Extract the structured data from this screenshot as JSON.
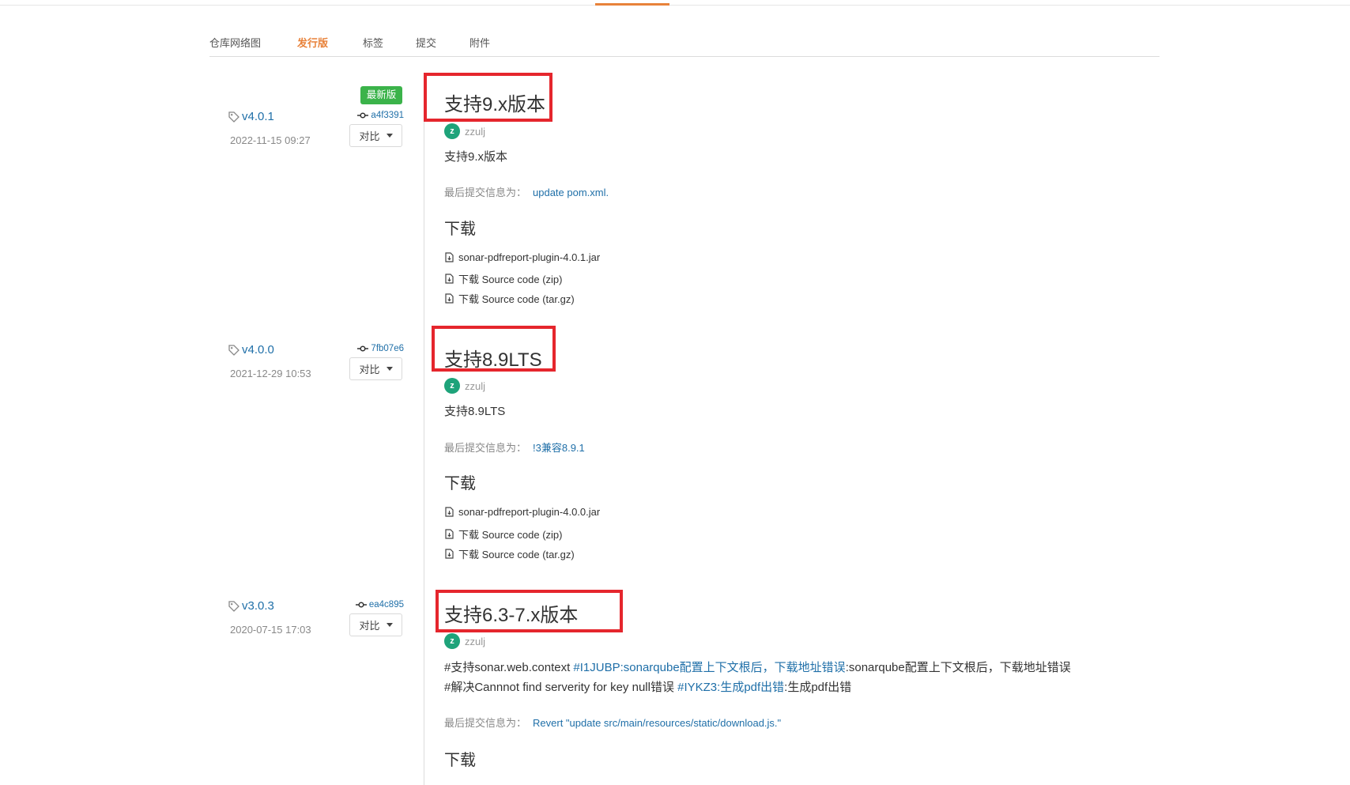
{
  "tabs": [
    "仓库网络图",
    "发行版",
    "标签",
    "提交",
    "附件"
  ],
  "active_tab": "发行版",
  "colors": {
    "accent": "#e8823a",
    "link": "#1f6fa8",
    "badge": "#3bb34a",
    "highlight_box": "#e5262d",
    "avatar": "#1ea37a"
  },
  "icons": {
    "tag": "tag-icon",
    "commit": "commit-icon",
    "file": "file-icon",
    "caret": "caret-down-icon"
  },
  "releases": [
    {
      "tag": "v4.0.1",
      "date": "2022-11-15 09:27",
      "commit": "a4f3391",
      "latest_label": "最新版",
      "compare_label": "对比",
      "title": "支持9.x版本",
      "author_initial": "z",
      "author": "zzulj",
      "description": [
        "支持9.x版本"
      ],
      "last_commit_label": "最后提交信息为：",
      "last_commit_message": "update pom.xml.",
      "download_title": "下载",
      "files": [
        "sonar-pdfreport-plugin-4.0.1.jar",
        "下载 Source code (zip)",
        "下载 Source code (tar.gz)"
      ]
    },
    {
      "tag": "v4.0.0",
      "date": "2021-12-29 10:53",
      "commit": "7fb07e6",
      "compare_label": "对比",
      "title": "支持8.9LTS",
      "author_initial": "z",
      "author": "zzulj",
      "description": [
        "支持8.9LTS"
      ],
      "last_commit_label": "最后提交信息为：",
      "last_commit_message": "!3兼容8.9.1",
      "download_title": "下载",
      "files": [
        "sonar-pdfreport-plugin-4.0.0.jar",
        "下载 Source code (zip)",
        "下载 Source code (tar.gz)"
      ]
    },
    {
      "tag": "v3.0.3",
      "date": "2020-07-15 17:03",
      "commit": "ea4c895",
      "compare_label": "对比",
      "title": "支持6.3-7.x版本",
      "author_initial": "z",
      "author": "zzulj",
      "description_line1": {
        "prefix": "#支持sonar.web.context ",
        "link": "#I1JUBP:sonarqube配置上下文根后，下载地址错误",
        "suffix": ":sonarqube配置上下文根后，下载地址错误"
      },
      "description_line2": {
        "prefix": "#解决Cannnot find serverity for key null错误 ",
        "link": "#IYKZ3:生成pdf出错",
        "suffix": ":生成pdf出错"
      },
      "last_commit_label": "最后提交信息为：",
      "last_commit_message": "Revert \"update src/main/resources/static/download.js.\"",
      "download_title": "下载"
    }
  ]
}
